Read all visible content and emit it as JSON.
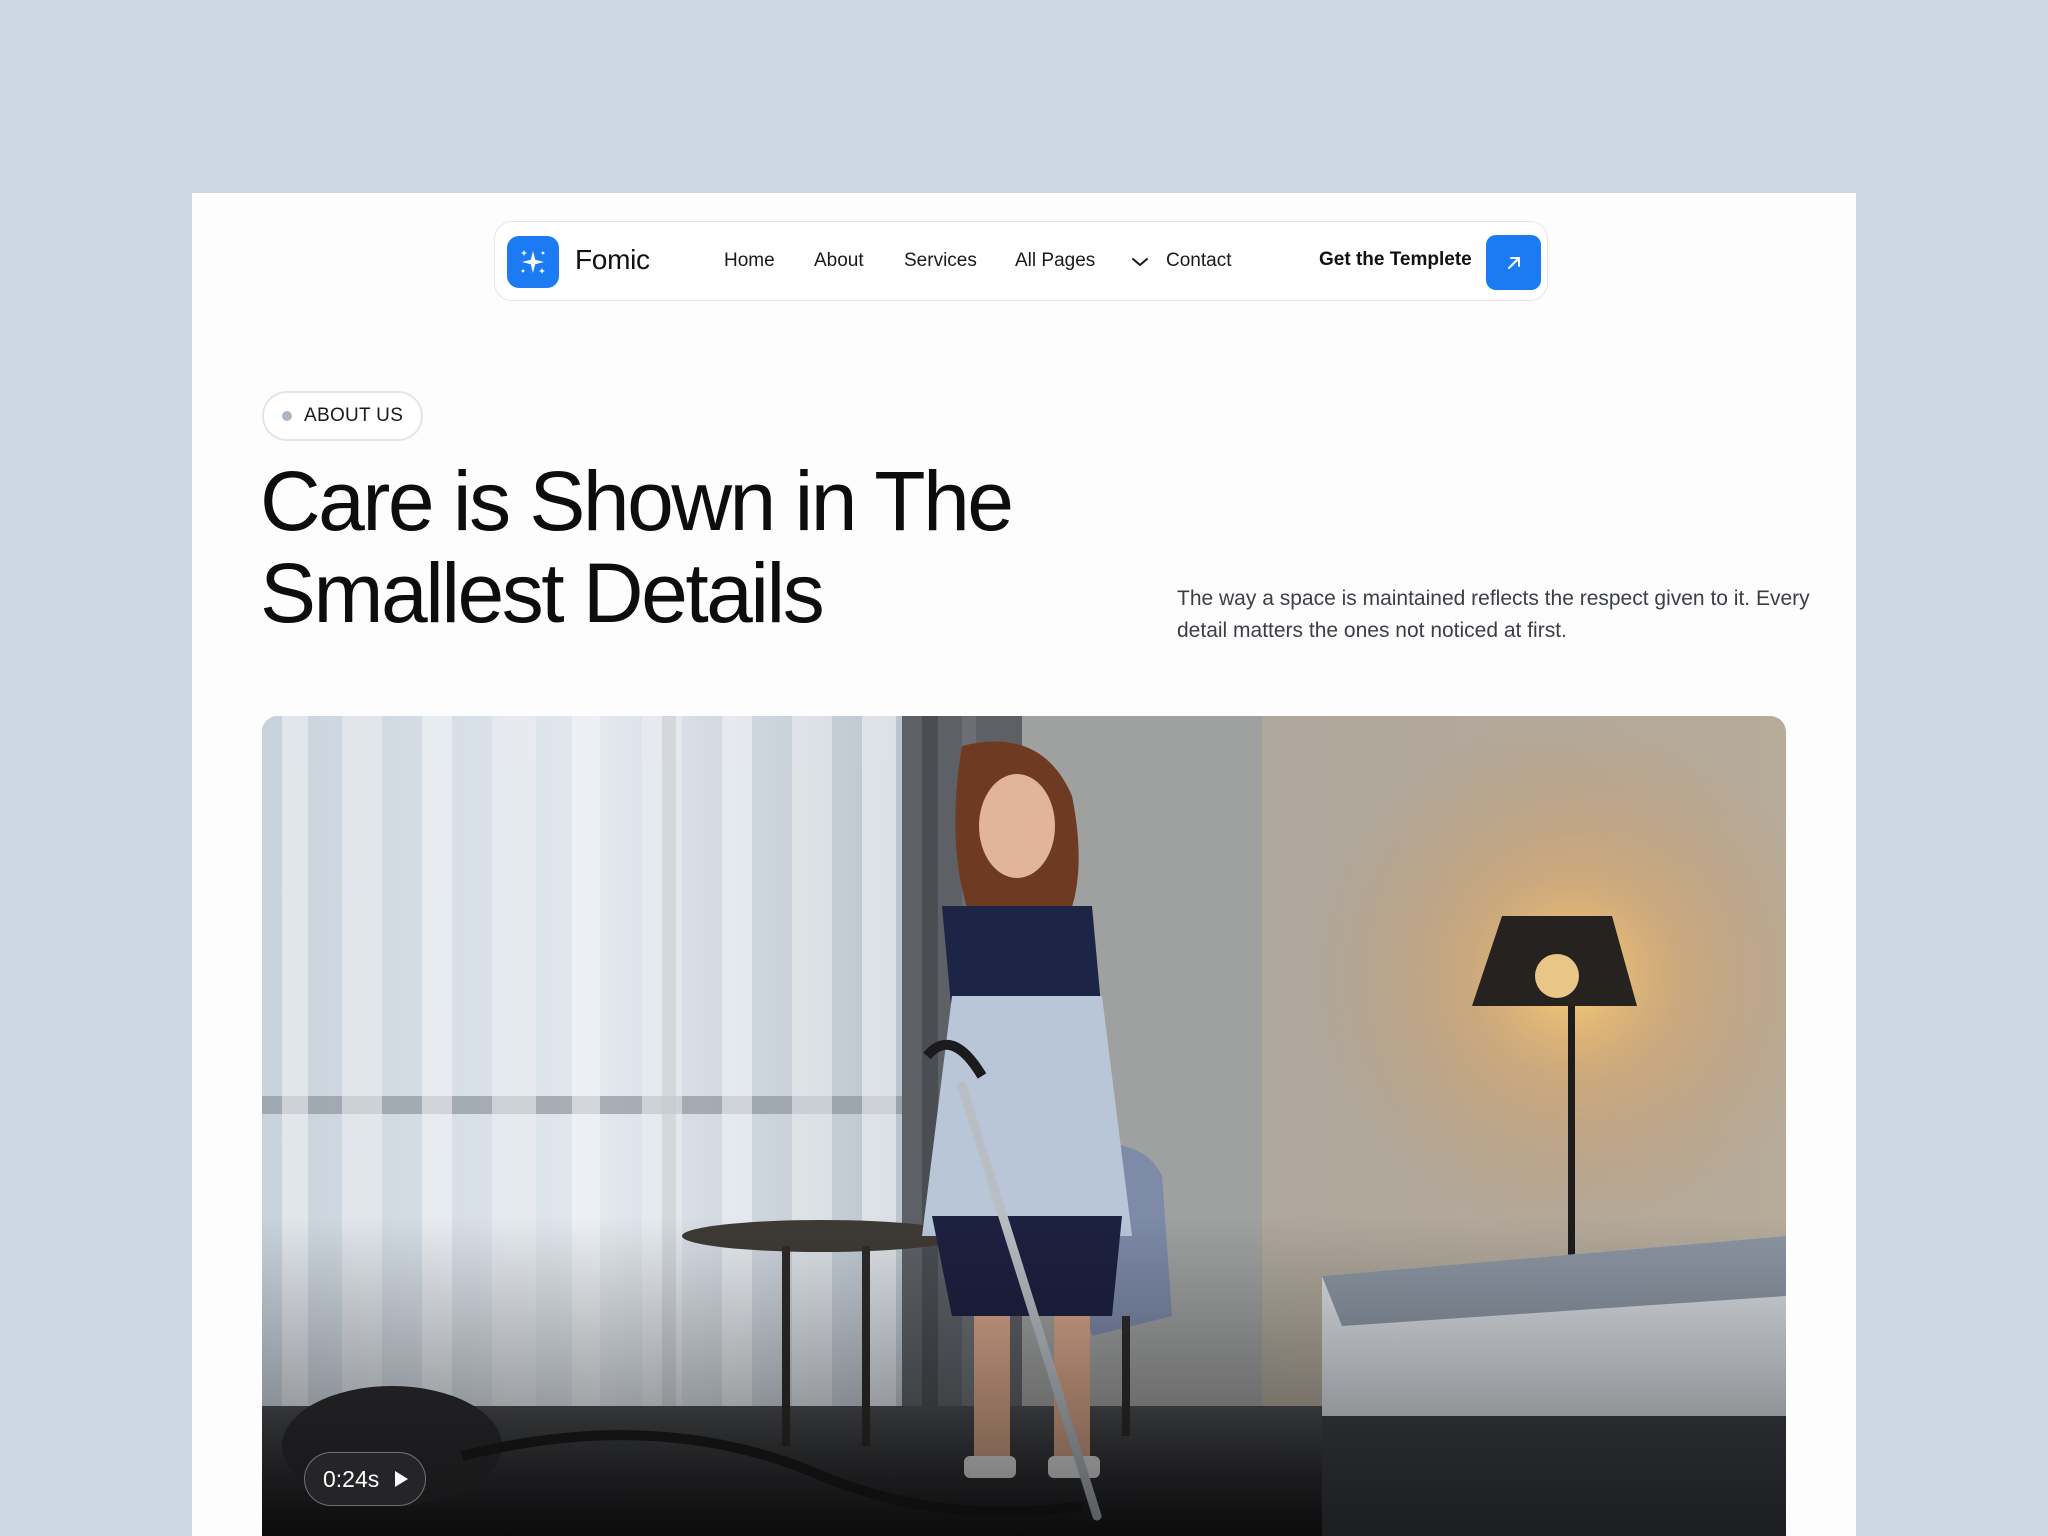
{
  "nav": {
    "brand": "Fomic",
    "links": [
      "Home",
      "About",
      "Services",
      "All Pages",
      "Contact"
    ],
    "cta_label": "Get the Templete"
  },
  "hero": {
    "badge": "ABOUT US",
    "title_line1": "Care is Shown in The",
    "title_line2": "Smallest Details",
    "description": "The way a space is maintained reflects the respect given to it. Every detail matters the ones not noticed at first."
  },
  "video": {
    "duration": "0:24s"
  },
  "colors": {
    "accent": "#1c7bf2",
    "background": "#cbd7e3",
    "card": "#fdfdfd"
  }
}
